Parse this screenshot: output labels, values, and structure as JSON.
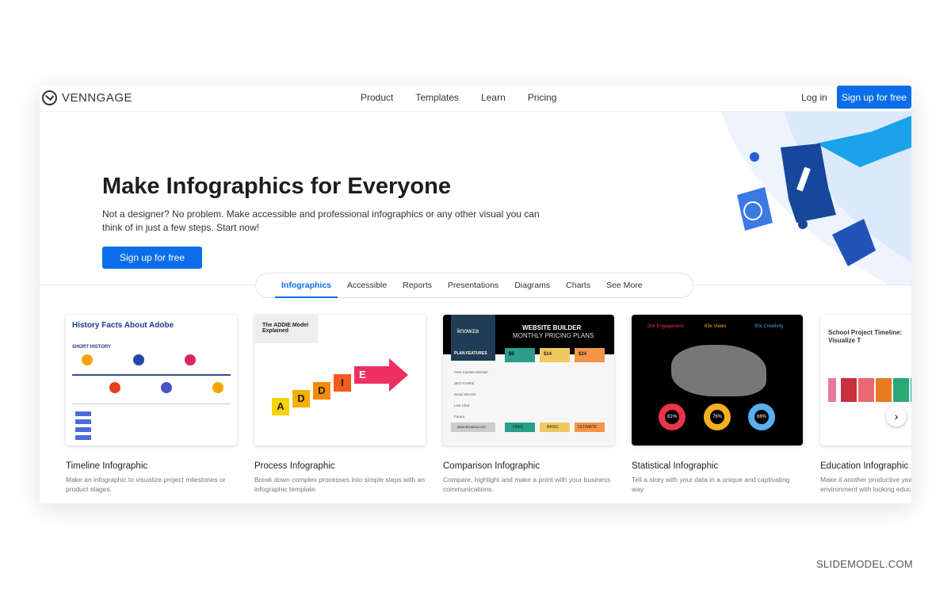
{
  "nav": {
    "brand": "VENNGAGE",
    "menu": [
      "Product",
      "Templates",
      "Learn",
      "Pricing"
    ],
    "login": "Log in",
    "signup": "Sign up for free"
  },
  "hero": {
    "title": "Make Infographics for Everyone",
    "subtitle": "Not a designer? No problem. Make accessible and professional infographics or any other visual you can think of in just a few steps. Start now!",
    "cta": "Sign up for free"
  },
  "tabs": [
    {
      "label": "Infographics",
      "active": true
    },
    {
      "label": "Accessible"
    },
    {
      "label": "Reports"
    },
    {
      "label": "Presentations"
    },
    {
      "label": "Diagrams"
    },
    {
      "label": "Charts"
    },
    {
      "label": "See More"
    }
  ],
  "cards": [
    {
      "title": "Timeline Infographic",
      "desc": "Make an infographic to visualize project milestones or product stages.",
      "thumb": {
        "heading": "History Facts About Adobe",
        "section": "SHORT HISTORY"
      }
    },
    {
      "title": "Process Infographic",
      "desc": "Break down complex processes into simple steps with an infographic template.",
      "thumb": {
        "heading": "The ADDIE Model Explained",
        "letters": [
          "A",
          "D",
          "D",
          "I",
          "E"
        ]
      }
    },
    {
      "title": "Comparison Infographic",
      "desc": "Compare, highlight and make a point with your business communications.",
      "thumb": {
        "brand": "knowza",
        "heading": "WEBSITE BUILDER",
        "subheading": "MONTHLY PRICING PLANS",
        "features_label": "PLAN FEATURES",
        "prices": [
          "$0",
          "$14",
          "$24"
        ],
        "plans": [
          "FREE",
          "BASIC",
          "ULTIMATE"
        ],
        "features": [
          "Free Custom Domain",
          "SEO Control",
          "Email Service",
          "Live Chat",
          "Forum"
        ],
        "url": "www.knowza.com"
      }
    },
    {
      "title": "Statistical Infographic",
      "desc": "Tell a story with your data in a unique and captivating way.",
      "thumb": {
        "stats": [
          "20x Engagement",
          "63x Views",
          "50x Creativity"
        ],
        "donuts": [
          "81%",
          "76%",
          "68%"
        ]
      }
    },
    {
      "title": "Education Infographic",
      "desc": "Make it another productive year to the learning environment with looking education templates.",
      "thumb": {
        "heading": "School Project Timeline: Visualize T"
      }
    }
  ],
  "credit": "SLIDEMODEL.COM",
  "colors": {
    "accent": "#0b6ee8",
    "dark_blue": "#1a4fa3"
  }
}
